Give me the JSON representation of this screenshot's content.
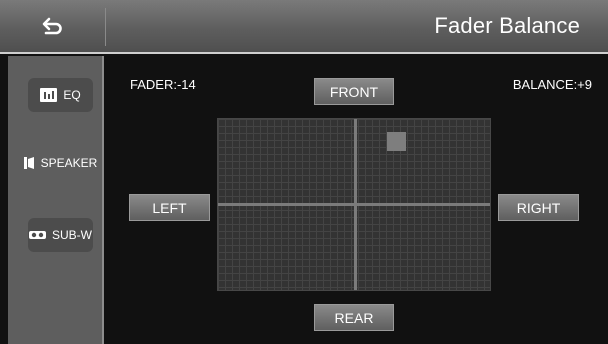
{
  "header": {
    "title": "Fader Balance"
  },
  "icons": {
    "back": "back-arrow-icon",
    "eq": "equalizer-icon",
    "speaker": "speaker-icon",
    "subwoofer": "subwoofer-icon"
  },
  "sidebar": {
    "items": [
      {
        "label": "EQ",
        "icon": "equalizer-icon"
      },
      {
        "label": "SPEAKER",
        "icon": "speaker-icon"
      },
      {
        "label": "SUB-W",
        "icon": "subwoofer-icon"
      }
    ]
  },
  "fader_text": "FADER:-14",
  "balance_text": "BALANCE:+9",
  "fader_value": -14,
  "balance_value": 9,
  "buttons": {
    "front": "FRONT",
    "rear": "REAR",
    "left": "LEFT",
    "right": "RIGHT"
  },
  "colors": {
    "header": "#5e5e5e",
    "background": "#111111",
    "grid": "#333333",
    "marker": "#7e7e7e"
  }
}
